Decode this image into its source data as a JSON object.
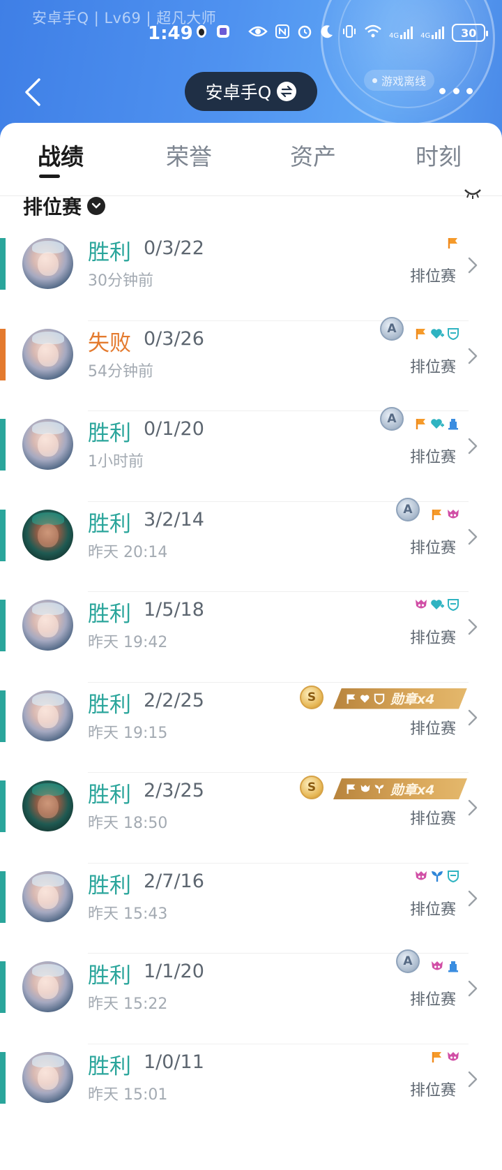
{
  "header": {
    "profile_line": "安卓手Q | Lv69 | 超凡大师",
    "status_time": "1:49",
    "battery": "30",
    "network_a": "4G",
    "network_b": "4G",
    "title": "安卓手Q",
    "offline_status": "游戏离线"
  },
  "tabs": [
    {
      "label": "战绩"
    },
    {
      "label": "荣誉"
    },
    {
      "label": "资产"
    },
    {
      "label": "时刻"
    }
  ],
  "section": {
    "title": "排位赛"
  },
  "colors": {
    "win": "#2aa59b",
    "loss": "#e47a2e",
    "header_blue": "#4f92f0"
  },
  "matches": [
    {
      "result": "胜利",
      "kda": "0/3/22",
      "time": "30分钟前",
      "mode": "排位赛",
      "hero": "hero-a",
      "rank_icon": "",
      "badges": [
        "flag-icon"
      ],
      "medal": ""
    },
    {
      "result": "失败",
      "kda": "0/3/26",
      "time": "54分钟前",
      "mode": "排位赛",
      "hero": "hero-a",
      "rank_icon": "A",
      "badges": [
        "flag-icon",
        "heart-plus-icon",
        "shield-icon"
      ],
      "medal": ""
    },
    {
      "result": "胜利",
      "kda": "0/1/20",
      "time": "1小时前",
      "mode": "排位赛",
      "hero": "hero-a",
      "rank_icon": "A",
      "badges": [
        "flag-icon",
        "heart-plus-icon",
        "tower-icon"
      ],
      "medal": ""
    },
    {
      "result": "胜利",
      "kda": "3/2/14",
      "time": "昨天 20:14",
      "mode": "排位赛",
      "hero": "hero-b",
      "rank_icon": "A",
      "badges": [
        "flag-icon",
        "demon-icon"
      ],
      "medal": ""
    },
    {
      "result": "胜利",
      "kda": "1/5/18",
      "time": "昨天 19:42",
      "mode": "排位赛",
      "hero": "hero-a",
      "rank_icon": "",
      "badges": [
        "demon-icon",
        "heart-plus-icon",
        "shield-icon"
      ],
      "medal": ""
    },
    {
      "result": "胜利",
      "kda": "2/2/25",
      "time": "昨天 19:15",
      "mode": "排位赛",
      "hero": "hero-a",
      "rank_icon": "S",
      "badges": [],
      "medal": "勋章x4"
    },
    {
      "result": "胜利",
      "kda": "2/3/25",
      "time": "昨天 18:50",
      "mode": "排位赛",
      "hero": "hero-b",
      "rank_icon": "S",
      "badges": [],
      "medal": "勋章x4"
    },
    {
      "result": "胜利",
      "kda": "2/7/16",
      "time": "昨天 15:43",
      "mode": "排位赛",
      "hero": "hero-a",
      "rank_icon": "",
      "badges": [
        "demon-icon",
        "sprout-icon",
        "shield-icon"
      ],
      "medal": ""
    },
    {
      "result": "胜利",
      "kda": "1/1/20",
      "time": "昨天 15:22",
      "mode": "排位赛",
      "hero": "hero-a",
      "rank_icon": "A",
      "badges": [
        "demon-icon",
        "tower-icon"
      ],
      "medal": ""
    },
    {
      "result": "胜利",
      "kda": "1/0/11",
      "time": "昨天 15:01",
      "mode": "排位赛",
      "hero": "hero-a",
      "rank_icon": "",
      "badges": [
        "flag-icon",
        "demon-icon"
      ],
      "medal": ""
    }
  ]
}
